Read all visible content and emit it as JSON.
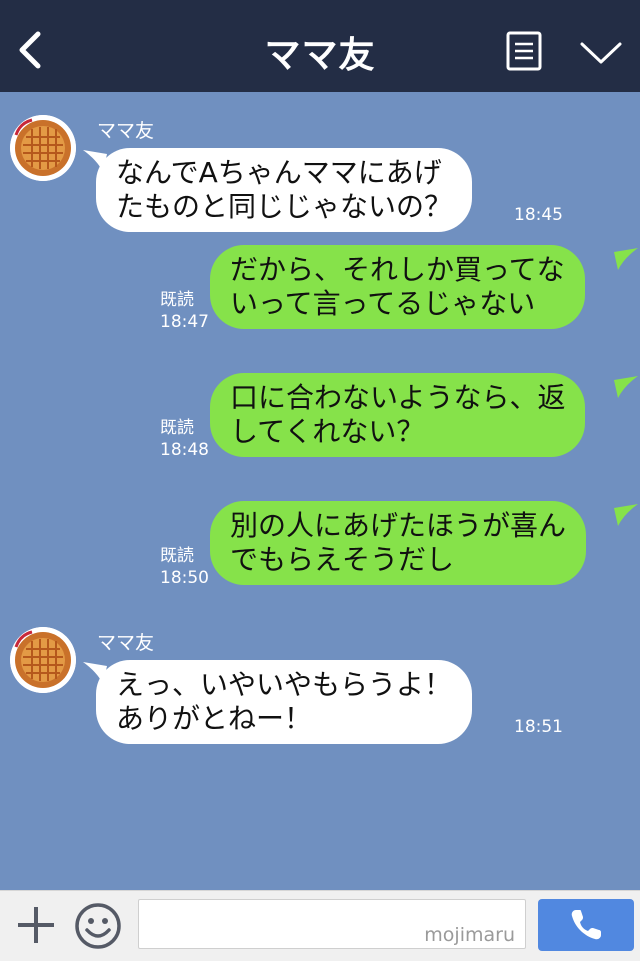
{
  "header": {
    "title": "ママ友",
    "back_icon": "chevron-left-icon",
    "notes_icon": "notes-icon",
    "menu_icon": "chevron-down-icon"
  },
  "messages": [
    {
      "direction": "in",
      "sender": "ママ友",
      "lines": [
        "なんでAちゃんママにあげ",
        "たものと同じじゃないの？"
      ],
      "time": "18:45"
    },
    {
      "direction": "out",
      "read": "既読",
      "lines": [
        "だから、それしか買ってな",
        "いって言ってるじゃない"
      ],
      "time": "18:47"
    },
    {
      "direction": "out",
      "read": "既読",
      "lines": [
        "口に合わないようなら、返",
        "してくれない？"
      ],
      "time": "18:48"
    },
    {
      "direction": "out",
      "read": "既読",
      "lines": [
        "別の人にあげたほうが喜ん",
        "でもらえそうだし"
      ],
      "time": "18:50"
    },
    {
      "direction": "in",
      "sender": "ママ友",
      "lines": [
        "えっ、いやいやもらうよ！",
        "ありがとねー！"
      ],
      "time": "18:51"
    }
  ],
  "footer": {
    "input_value": "",
    "watermark": "mojimaru",
    "plus_icon": "plus-icon",
    "emoji_icon": "smile-icon",
    "call_icon": "phone-icon"
  },
  "colors": {
    "background": "#7090c0",
    "header": "#232d45",
    "incoming_bubble": "#ffffff",
    "outgoing_bubble": "#86e24a",
    "call_button": "#5188e0"
  }
}
